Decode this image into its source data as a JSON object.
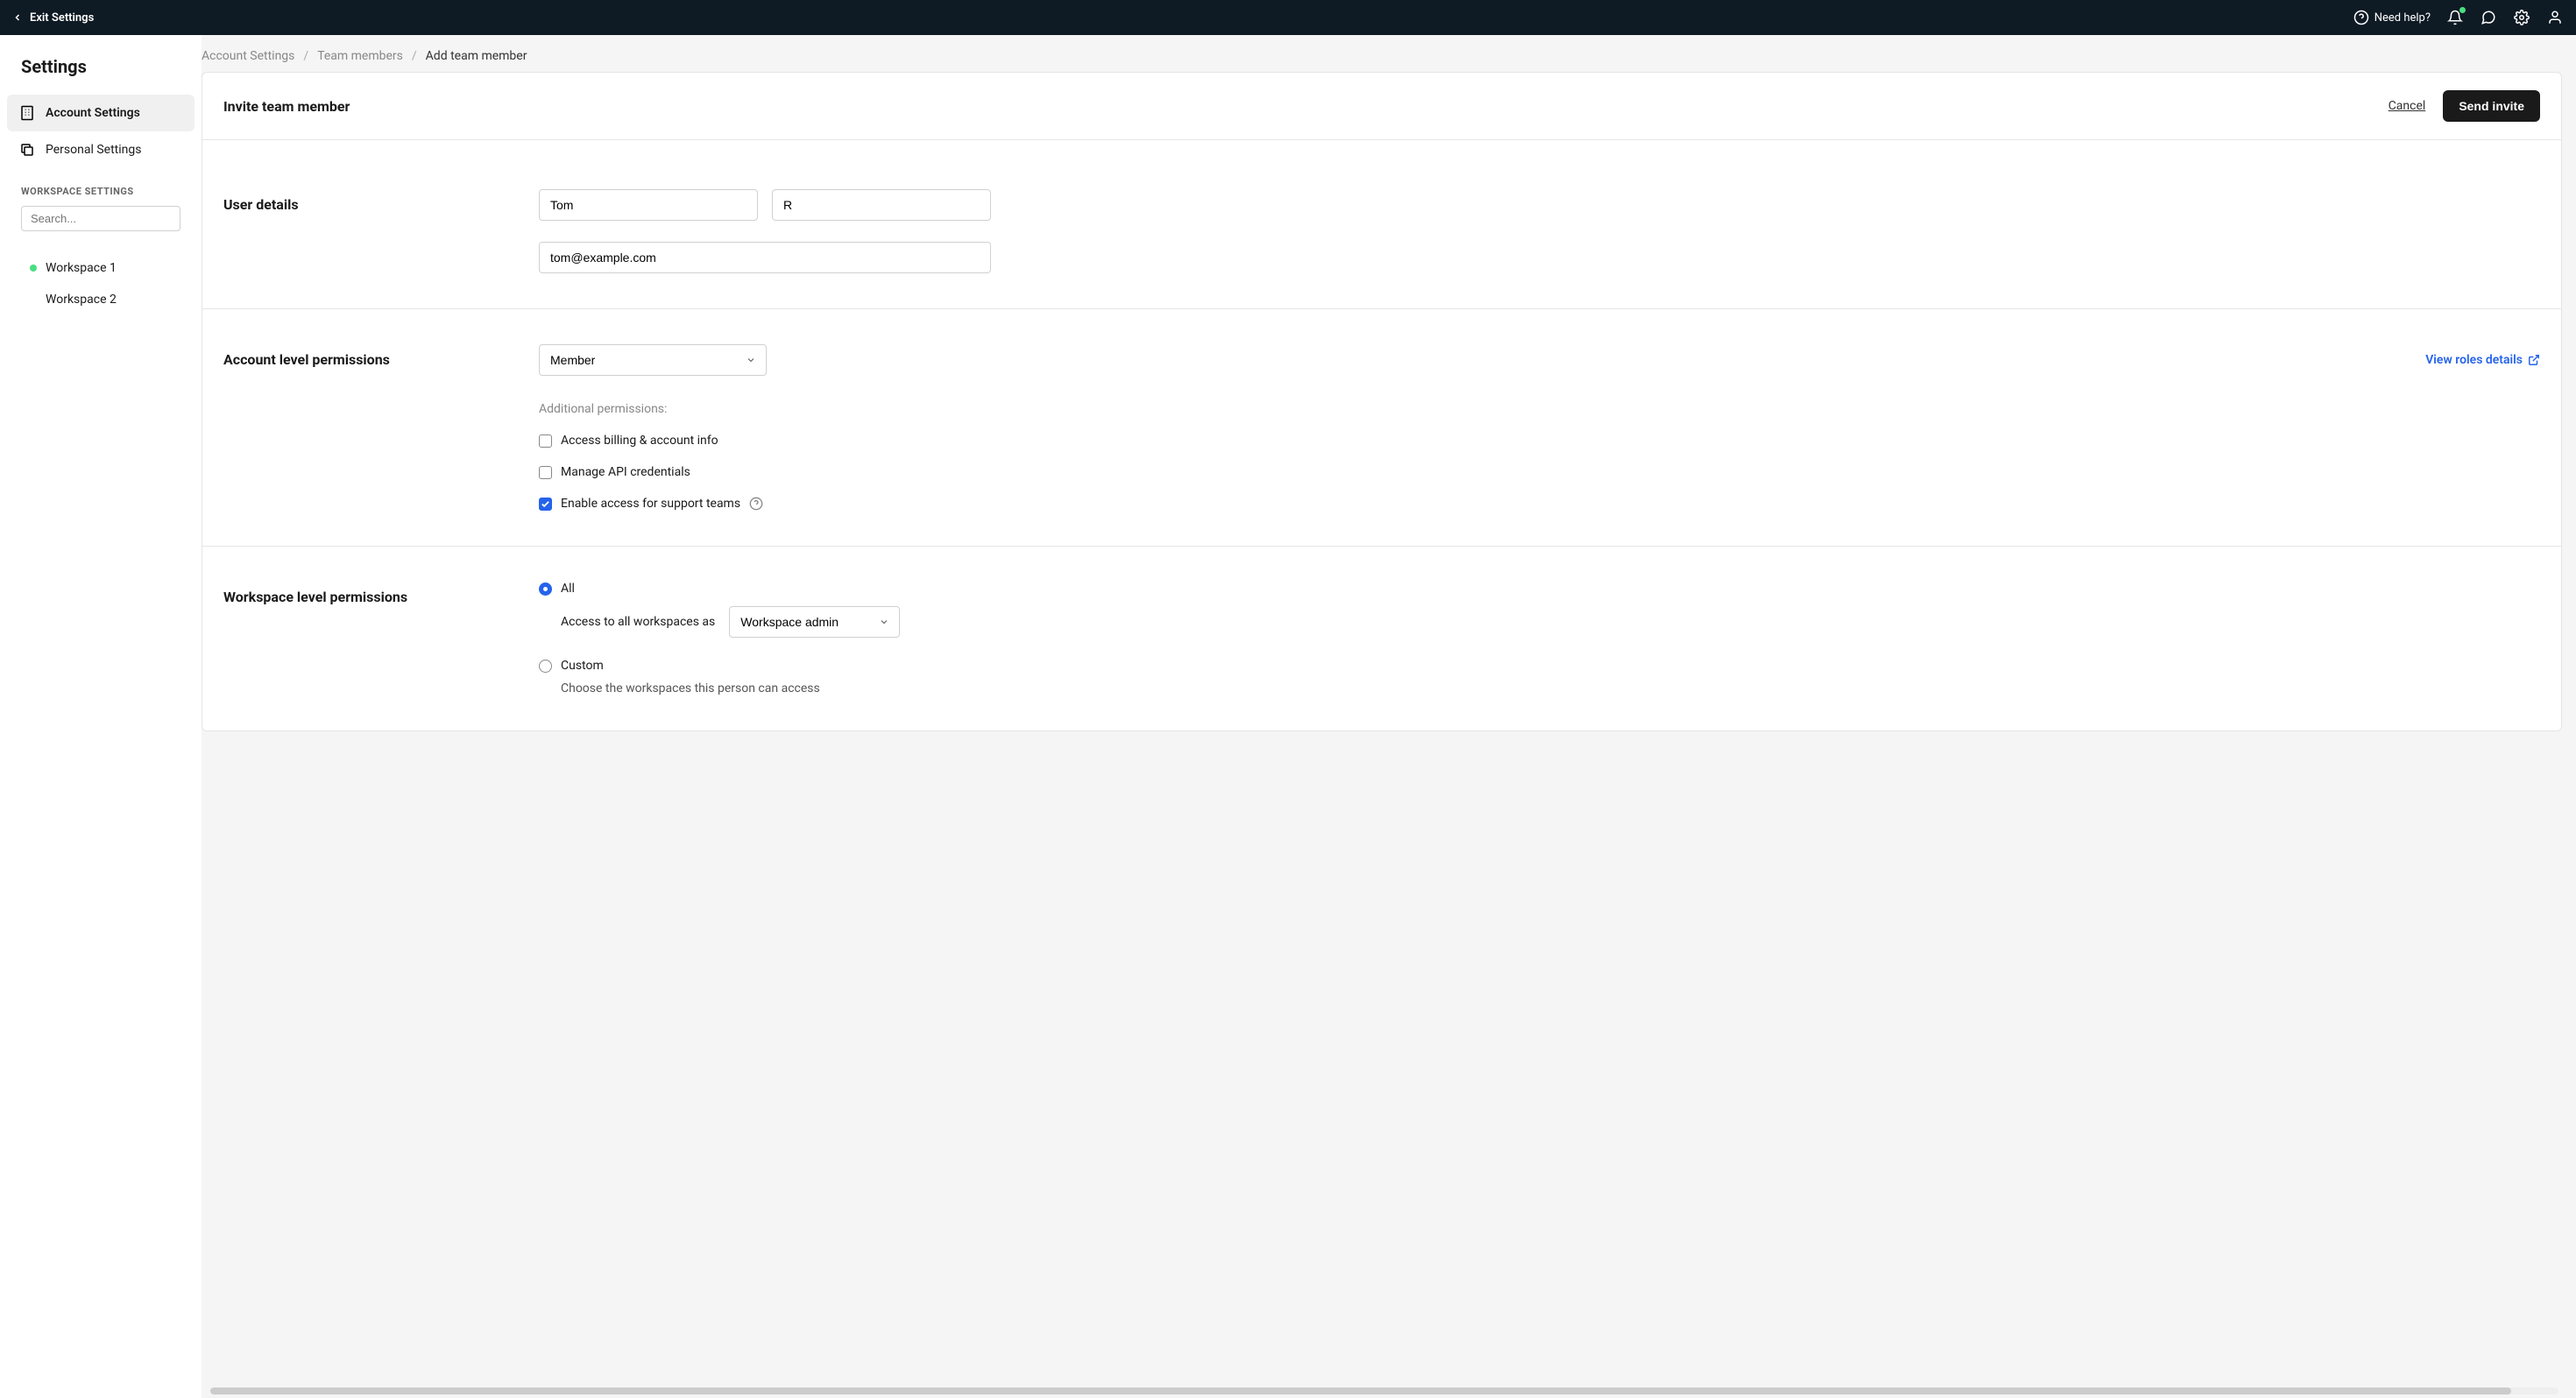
{
  "topbar": {
    "exit_label": "Exit Settings",
    "help_label": "Need help?"
  },
  "sidebar": {
    "title": "Settings",
    "nav": {
      "account": "Account Settings",
      "personal": "Personal Settings"
    },
    "ws_header": "WORKSPACE SETTINGS",
    "search_placeholder": "Search...",
    "workspaces": [
      {
        "label": "Workspace 1",
        "active": true
      },
      {
        "label": "Workspace 2",
        "active": false
      }
    ]
  },
  "breadcrumb": {
    "c1": "Account Settings",
    "c2": "Team members",
    "c3": "Add team member"
  },
  "header": {
    "title": "Invite team member",
    "cancel": "Cancel",
    "send": "Send invite"
  },
  "user_details": {
    "label": "User details",
    "first_name": "Tom",
    "last_name": "R",
    "email": "tom@example.com"
  },
  "account_perms": {
    "label": "Account level permissions",
    "role": "Member",
    "view_roles": "View roles details",
    "additional_label": "Additional permissions:",
    "perm1": "Access billing & account info",
    "perm2": "Manage API credentials",
    "perm3": "Enable access for support teams"
  },
  "workspace_perms": {
    "label": "Workspace level permissions",
    "all_label": "All",
    "all_desc": "Access to all workspaces as",
    "all_role": "Workspace admin",
    "custom_label": "Custom",
    "custom_desc": "Choose the workspaces this person can access"
  }
}
